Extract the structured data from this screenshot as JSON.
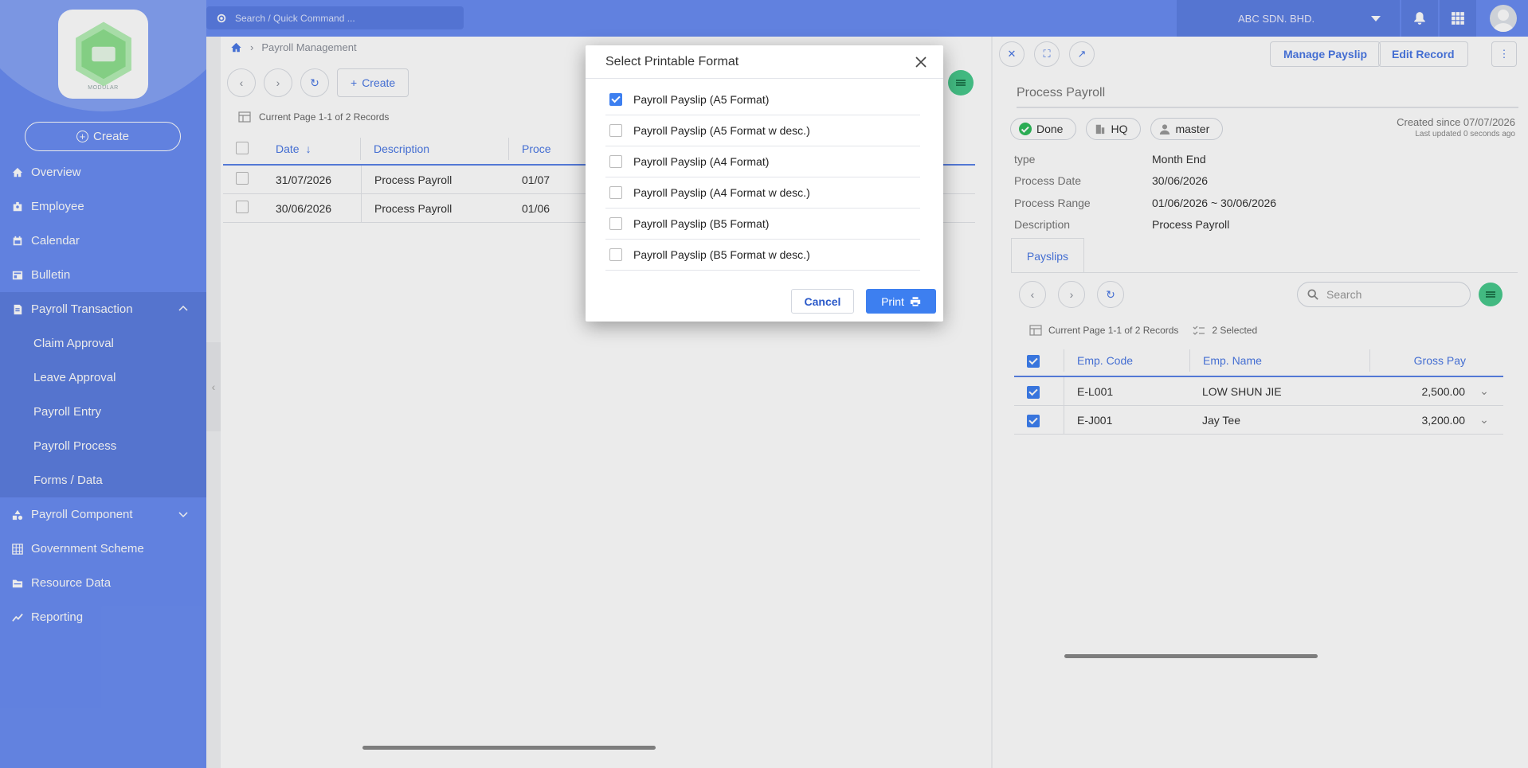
{
  "topbar": {
    "search_placeholder": "Search / Quick Command ...",
    "company": "ABC SDN. BHD."
  },
  "sidebar": {
    "logo_text": "MODULAR",
    "create_label": "Create",
    "items": [
      {
        "label": "Overview",
        "icon": "home-icon"
      },
      {
        "label": "Employee",
        "icon": "badge-icon"
      },
      {
        "label": "Calendar",
        "icon": "calendar-icon"
      },
      {
        "label": "Bulletin",
        "icon": "bulletin-icon"
      },
      {
        "label": "Payroll Transaction",
        "icon": "document-icon",
        "expanded": true
      },
      {
        "label": "Payroll Component",
        "icon": "shapes-icon"
      },
      {
        "label": "Government Scheme",
        "icon": "grid-icon"
      },
      {
        "label": "Resource Data",
        "icon": "folder-icon"
      },
      {
        "label": "Reporting",
        "icon": "chart-line-icon"
      }
    ],
    "subitems": [
      "Claim Approval",
      "Leave Approval",
      "Payroll Entry",
      "Payroll Process",
      "Forms / Data"
    ]
  },
  "main": {
    "breadcrumb": "Payroll Management",
    "create_label": "Create",
    "records_info": "Current Page 1-1 of 2 Records",
    "columns": [
      "Date",
      "Description",
      "Proce"
    ],
    "rows": [
      {
        "date": "31/07/2026",
        "description": "Process Payroll",
        "range": "01/07"
      },
      {
        "date": "30/06/2026",
        "description": "Process Payroll",
        "range": "01/06"
      }
    ]
  },
  "detail": {
    "manage_payslip": "Manage Payslip",
    "edit_record": "Edit Record",
    "title": "Process Payroll",
    "tags": [
      "Done",
      "HQ",
      "master"
    ],
    "created": "Created since 07/07/2026",
    "updated": "Last updated 0 seconds ago",
    "fields": [
      {
        "k": "type",
        "v": "Month End"
      },
      {
        "k": "Process Date",
        "v": "30/06/2026"
      },
      {
        "k": "Process Range",
        "v": "01/06/2026 ~ 30/06/2026"
      },
      {
        "k": "Description",
        "v": "Process Payroll"
      }
    ],
    "tab": "Payslips",
    "search_placeholder": "Search",
    "records_info": "Current Page 1-1 of 2 Records",
    "selected_info": "2 Selected",
    "columns": [
      "Emp. Code",
      "Emp. Name",
      "Gross Pay"
    ],
    "rows": [
      {
        "code": "E-L001",
        "name": "LOW SHUN JIE",
        "gross": "2,500.00"
      },
      {
        "code": "E-J001",
        "name": "Jay Tee",
        "gross": "3,200.00"
      }
    ]
  },
  "modal": {
    "title": "Select Printable Format",
    "options": [
      {
        "label": "Payroll Payslip (A5 Format)",
        "checked": true
      },
      {
        "label": "Payroll Payslip (A5 Format w desc.)",
        "checked": false
      },
      {
        "label": "Payroll Payslip (A4 Format)",
        "checked": false
      },
      {
        "label": "Payroll Payslip (A4 Format w desc.)",
        "checked": false
      },
      {
        "label": "Payroll Payslip (B5 Format)",
        "checked": false
      },
      {
        "label": "Payroll Payslip (B5 Format w desc.)",
        "checked": false
      }
    ],
    "cancel_label": "Cancel",
    "print_label": "Print"
  },
  "colors": {
    "sidebar": "#6a8df2",
    "accent": "#3d7ff0",
    "success": "#2fbb5c"
  }
}
